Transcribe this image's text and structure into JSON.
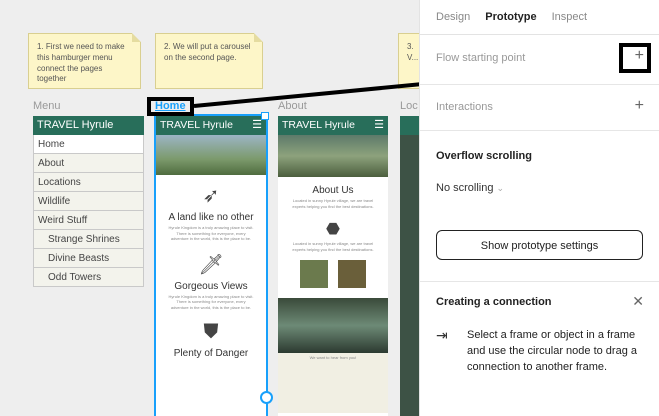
{
  "notes": [
    "1. First we need to make this hamburger menu connect the pages together",
    "2. We will put a carousel on the second page.",
    "3. V..."
  ],
  "frames": {
    "menu": "Menu",
    "home": "Home",
    "about": "About",
    "loc": "Loc"
  },
  "menu": {
    "head": "TRAVEL Hyrule",
    "items": [
      "Home",
      "About",
      "Locations",
      "Wildlife",
      "Weird Stuff",
      "Strange Shrines",
      "Divine Beasts",
      "Odd Towers"
    ]
  },
  "home": {
    "head": "TRAVEL Hyrule",
    "s1": "A land like no other",
    "s2": "Gorgeous Views",
    "s3": "Plenty of Danger",
    "lorem": "Hyrule Kingdom is a truly amazing place to visit. There is something for everyone, every adventure in the world, this is the place to be."
  },
  "about": {
    "head": "TRAVEL Hyrule",
    "title": "About Us",
    "lorem": "Located in sunny Hyrule village, we are travel experts helping you find the best destinations.",
    "form": "We want to hear from you!"
  },
  "panel": {
    "tabs": [
      "Design",
      "Prototype",
      "Inspect"
    ],
    "flow": "Flow starting point",
    "interactions": "Interactions",
    "overflow": "Overflow scrolling",
    "overflow_value": "No scrolling",
    "show_settings": "Show prototype settings",
    "connection_title": "Creating a connection",
    "connection_text": "Select a frame or object in a frame and use the circular node to drag a connection to another frame."
  },
  "colors": {
    "accent": "#286e5a",
    "selection": "#18a0fb",
    "note": "#fdf6c8"
  }
}
